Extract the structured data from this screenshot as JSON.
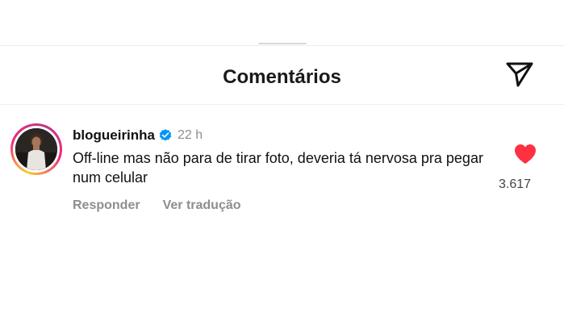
{
  "header": {
    "title": "Comentários"
  },
  "icons": {
    "send": "send-paper-plane-icon",
    "verified": "verified-badge-icon",
    "like": "heart-filled-icon"
  },
  "colors": {
    "verified_blue": "#0095f6",
    "like_red": "#ff3040",
    "muted_text": "#8e8e8e"
  },
  "comment": {
    "username": "blogueirinha",
    "verified": true,
    "time": "22 h",
    "text": "Off-line mas não para de tirar foto, deveria tá nervosa pra pegar num celular",
    "actions": {
      "reply": "Responder",
      "translate": "Ver tradução"
    },
    "liked": true,
    "like_count": "3.617"
  }
}
